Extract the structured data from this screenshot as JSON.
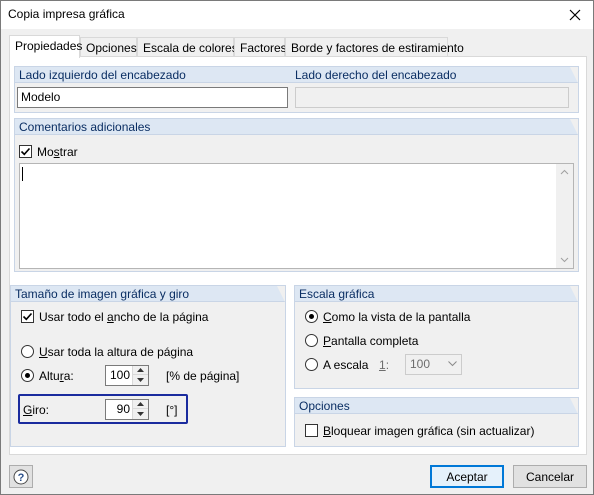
{
  "window": {
    "title": "Copia impresa gráfica"
  },
  "tabs": [
    {
      "label": "Propiedades",
      "active": true
    },
    {
      "label": "Opciones",
      "active": false
    },
    {
      "label": "Escala de colores",
      "active": false
    },
    {
      "label": "Factores",
      "active": false
    },
    {
      "label": "Borde y factores de estiramiento",
      "active": false
    }
  ],
  "header_group": {
    "left_title": "Lado izquierdo del encabezado",
    "left_value": "Modelo",
    "right_title": "Lado derecho del encabezado",
    "right_value": ""
  },
  "comments_group": {
    "title": "Comentarios adicionales",
    "show_label_pre": "Mo",
    "show_label_accel": "s",
    "show_label_post": "trar",
    "show_checked": true,
    "text": ""
  },
  "size_group": {
    "title": "Tamaño de imagen gráfica y giro",
    "full_width": {
      "pre": "Usar todo el ",
      "accel": "a",
      "post": "ncho de la página",
      "checked": true
    },
    "full_height": {
      "pre": "",
      "accel": "U",
      "post": "sar toda la altura de página",
      "checked": false
    },
    "height": {
      "pre": "Altu",
      "accel": "r",
      "post": "a:",
      "checked": true,
      "value": "100",
      "unit": "[% de página]"
    },
    "rotation": {
      "accel": "G",
      "post": "iro:",
      "value": "90",
      "unit": "[°]"
    }
  },
  "scale_group": {
    "title": "Escala gráfica",
    "as_screen": {
      "pre": "",
      "accel": "C",
      "post": "omo la vista de la pantalla",
      "checked": true
    },
    "full_screen": {
      "pre": "",
      "accel": "P",
      "post": "antalla completa",
      "checked": false
    },
    "to_scale": {
      "pre": "A escala",
      "checked": false,
      "ratio_accel": "1",
      "ratio_post": ":",
      "ratio_value": "100"
    }
  },
  "options_group": {
    "title": "Opciones",
    "lock": {
      "pre": "",
      "accel": "B",
      "post": "loquear imagen gráfica (sin actualizar)",
      "checked": false
    }
  },
  "footer": {
    "accept_label": "Aceptar",
    "cancel_label": "Cancelar"
  },
  "colors": {
    "group_header_bg": "#dde7f3",
    "group_header_text": "#0a2e63",
    "highlight_border": "#1a2b9e",
    "default_button_border": "#0078d7"
  },
  "icons": {
    "close": "close-icon",
    "help": "help-icon",
    "check": "checkmark-icon",
    "spin_up": "spin-up-icon",
    "spin_down": "spin-down-icon",
    "dropdown": "chevron-down-icon"
  }
}
